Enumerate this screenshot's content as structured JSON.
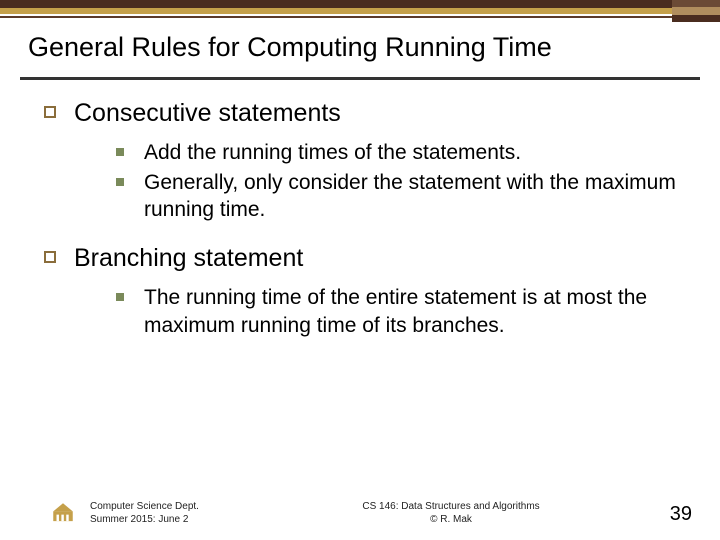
{
  "title": "General Rules for Computing Running Time",
  "sections": [
    {
      "heading": "Consecutive statements",
      "items": [
        "Add the running times of the statements.",
        "Generally, only consider the statement with the maximum running time."
      ]
    },
    {
      "heading": "Branching statement",
      "items": [
        "The running time of the entire statement is at most the maximum running time of its branches."
      ]
    }
  ],
  "footer": {
    "dept": "Computer Science Dept.",
    "term": "Summer 2015: June 2",
    "course": "CS 146: Data Structures and Algorithms",
    "author": "© R. Mak",
    "page": "39"
  }
}
